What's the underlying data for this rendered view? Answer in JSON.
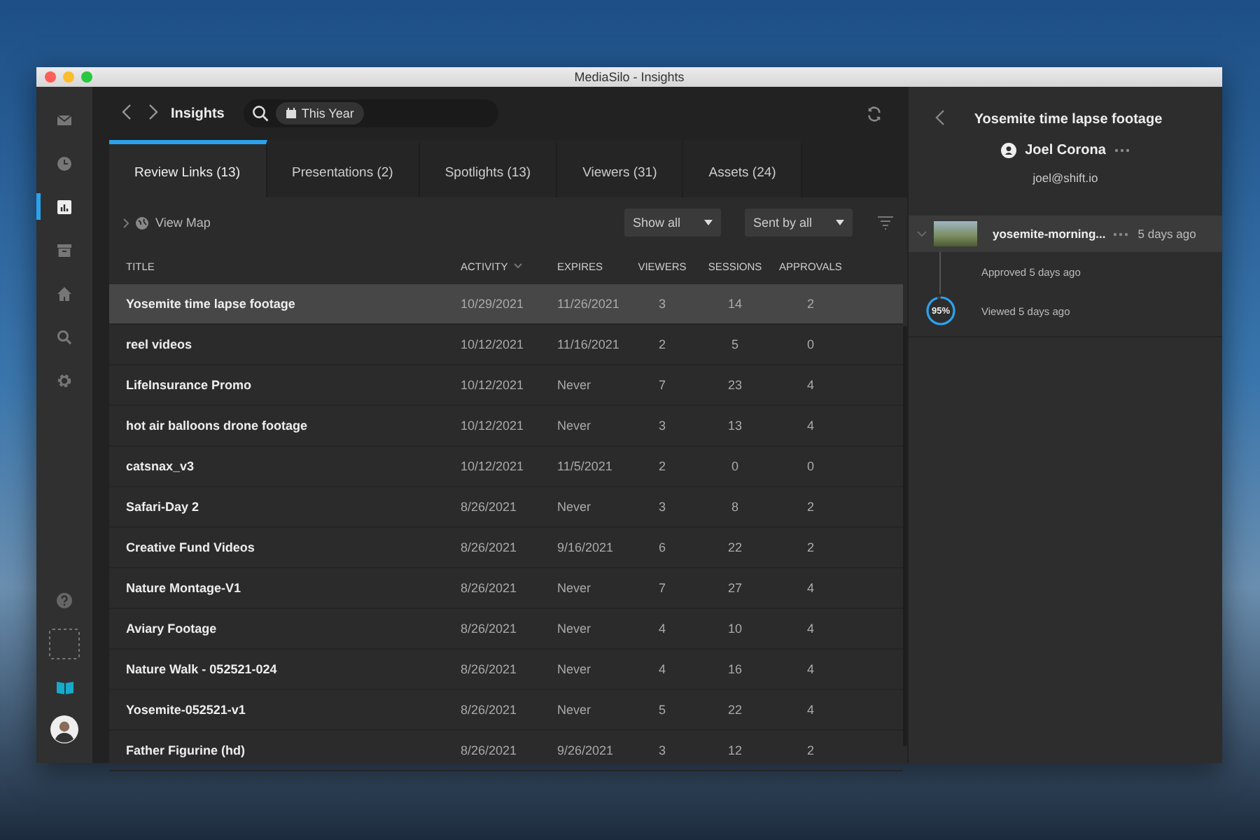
{
  "window": {
    "title": "MediaSilo - Insights"
  },
  "sidebar": {
    "items": [
      {
        "kind": "mail",
        "selected": false
      },
      {
        "kind": "clock",
        "selected": false
      },
      {
        "kind": "chart",
        "selected": true
      },
      {
        "kind": "archive",
        "selected": false
      },
      {
        "kind": "home",
        "selected": false
      },
      {
        "kind": "search",
        "selected": false
      },
      {
        "kind": "gear",
        "selected": false
      }
    ],
    "bottom": [
      {
        "kind": "help"
      },
      {
        "kind": "dashed"
      },
      {
        "kind": "book"
      },
      {
        "kind": "avatar"
      }
    ]
  },
  "header": {
    "title": "Insights",
    "filter_chip": "This Year"
  },
  "tabs": [
    {
      "label": "Review Links (13)",
      "selected": true
    },
    {
      "label": "Presentations (2)",
      "selected": false
    },
    {
      "label": "Spotlights (13)",
      "selected": false
    },
    {
      "label": "Viewers (31)",
      "selected": false
    },
    {
      "label": "Assets (24)",
      "selected": false
    }
  ],
  "toolbar": {
    "view_map": "View Map",
    "dropdowns": [
      "Show all",
      "Sent by all"
    ]
  },
  "table": {
    "columns": [
      {
        "label": "TITLE",
        "sorted": false
      },
      {
        "label": "ACTIVITY",
        "sorted": true
      },
      {
        "label": "EXPIRES",
        "sorted": false
      },
      {
        "label": "VIEWERS",
        "sorted": false
      },
      {
        "label": "SESSIONS",
        "sorted": false
      },
      {
        "label": "APPROVALS",
        "sorted": false
      }
    ],
    "rows": [
      {
        "cells": [
          "Yosemite time lapse footage",
          "10/29/2021",
          "11/26/2021",
          "3",
          "14",
          "2"
        ],
        "selected": true
      },
      {
        "cells": [
          "reel videos",
          "10/12/2021",
          "11/16/2021",
          "2",
          "5",
          "0"
        ],
        "selected": false
      },
      {
        "cells": [
          "LifeInsurance Promo",
          "10/12/2021",
          "Never",
          "7",
          "23",
          "4"
        ],
        "selected": false
      },
      {
        "cells": [
          "hot air balloons drone footage",
          "10/12/2021",
          "Never",
          "3",
          "13",
          "4"
        ],
        "selected": false
      },
      {
        "cells": [
          "catsnax_v3",
          "10/12/2021",
          "11/5/2021",
          "2",
          "0",
          "0"
        ],
        "selected": false
      },
      {
        "cells": [
          "Safari-Day 2",
          "8/26/2021",
          "Never",
          "3",
          "8",
          "2"
        ],
        "selected": false
      },
      {
        "cells": [
          "Creative Fund Videos",
          "8/26/2021",
          "9/16/2021",
          "6",
          "22",
          "2"
        ],
        "selected": false
      },
      {
        "cells": [
          "Nature Montage-V1",
          "8/26/2021",
          "Never",
          "7",
          "27",
          "4"
        ],
        "selected": false
      },
      {
        "cells": [
          "Aviary Footage",
          "8/26/2021",
          "Never",
          "4",
          "10",
          "4"
        ],
        "selected": false
      },
      {
        "cells": [
          "Nature Walk - 052521-024",
          "8/26/2021",
          "Never",
          "4",
          "16",
          "4"
        ],
        "selected": false
      },
      {
        "cells": [
          "Yosemite-052521-v1",
          "8/26/2021",
          "Never",
          "5",
          "22",
          "4"
        ],
        "selected": false
      },
      {
        "cells": [
          "Father Figurine (hd)",
          "8/26/2021",
          "9/26/2021",
          "3",
          "12",
          "2"
        ],
        "selected": false
      }
    ]
  },
  "detail": {
    "title": "Yosemite time lapse footage",
    "user": "Joel Corona",
    "email": "joel@shift.io",
    "asset": {
      "name": "yosemite-morning...",
      "time": "5 days ago",
      "expanded": true
    },
    "events": [
      {
        "kind": "approved",
        "text": "Approved 5 days ago"
      },
      {
        "kind": "viewed",
        "text": "Viewed 5 days ago",
        "level": 0.95,
        "reading": "95%"
      }
    ]
  }
}
